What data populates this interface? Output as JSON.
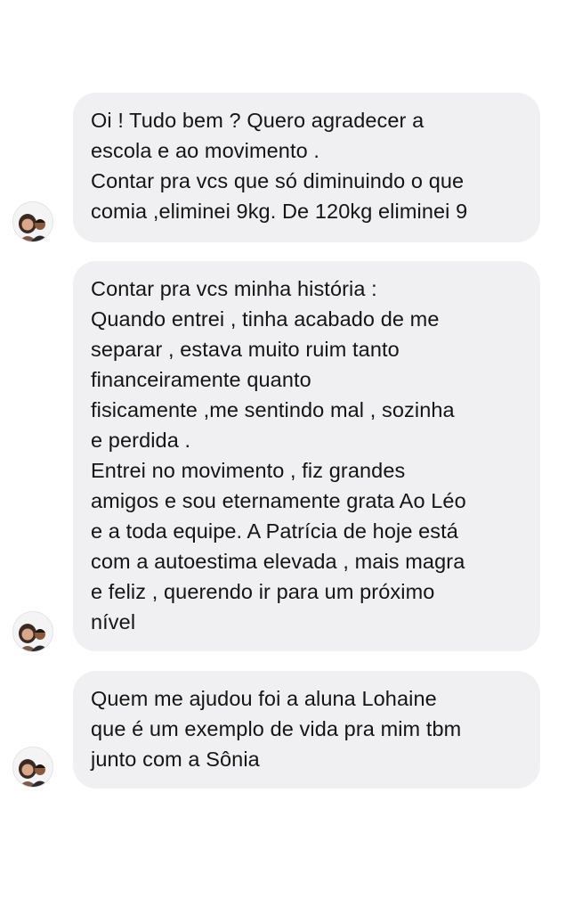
{
  "conversation": {
    "messages": [
      {
        "lines": [
          "Oi ! Tudo bem ? Quero agradecer a",
          "escola e ao movimento .",
          "Contar pra vcs que só diminuindo o que",
          "comia ,eliminei 9kg. De 120kg eliminei 9"
        ]
      },
      {
        "lines": [
          "Contar pra vcs minha história :",
          "Quando entrei , tinha acabado de me",
          "separar , estava muito ruim tanto",
          "financeiramente quanto",
          "fisicamente ,me sentindo mal , sozinha",
          "e perdida .",
          "Entrei no movimento , fiz grandes",
          "amigos e sou eternamente grata Ao Léo",
          "e a toda equipe. A Patrícia de hoje está",
          "com a autoestima elevada , mais magra",
          "e feliz , querendo ir para um próximo",
          "nível"
        ]
      },
      {
        "lines": [
          "Quem me ajudou foi a aluna Lohaine",
          "que é um exemplo de vida pra mim tbm",
          "junto com a Sônia"
        ]
      }
    ]
  },
  "colors": {
    "bubble_background": "#f0f0f2",
    "text": "#141414",
    "page_background": "#ffffff"
  },
  "icons": {
    "avatar": "profile-photo-avatar-icon"
  }
}
